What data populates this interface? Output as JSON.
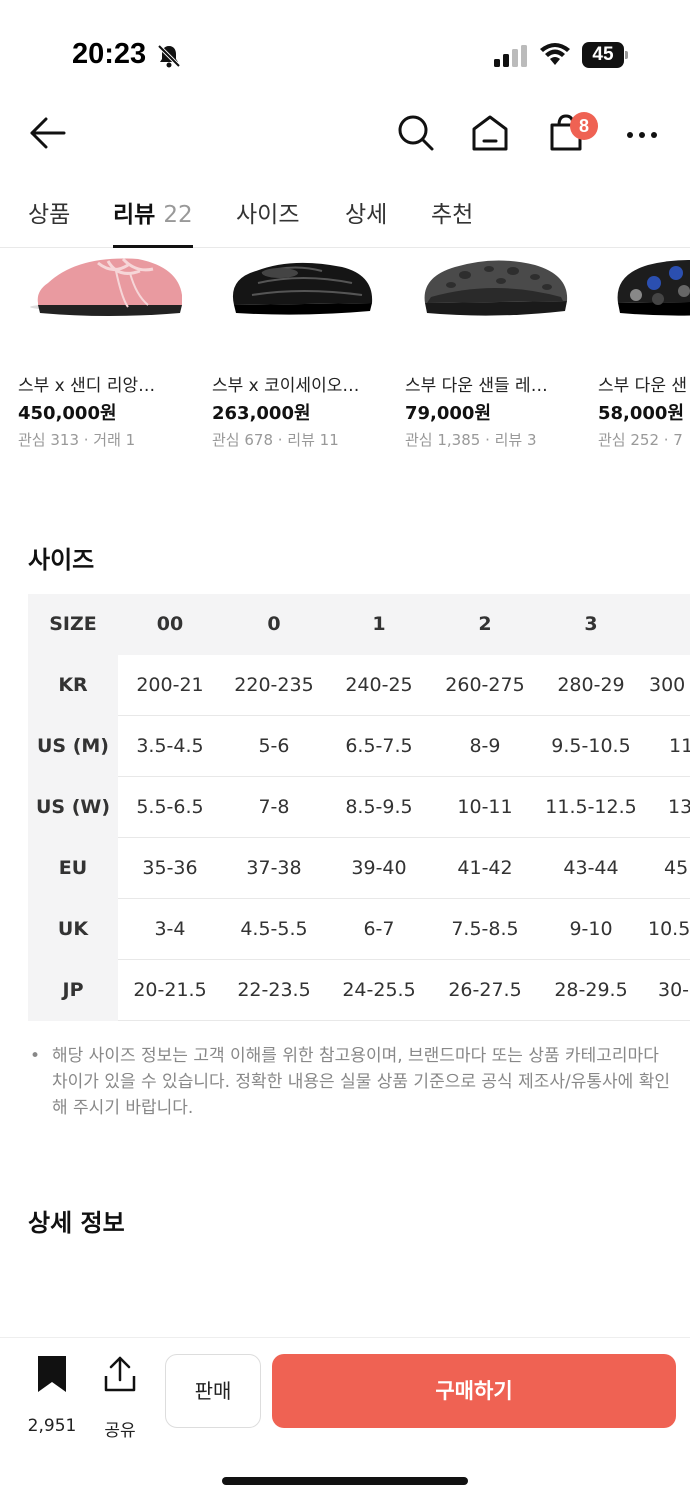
{
  "status_bar": {
    "time": "20:23",
    "battery": "45"
  },
  "header": {
    "cart_count": "8",
    "icons": [
      "back-arrow-icon",
      "search-icon",
      "home-icon",
      "cart-icon",
      "more-icon"
    ]
  },
  "tabs": [
    {
      "label": "상품"
    },
    {
      "label": "리뷰",
      "count": "22",
      "active": true
    },
    {
      "label": "사이즈"
    },
    {
      "label": "상세"
    },
    {
      "label": "추천"
    }
  ],
  "products": [
    {
      "name": "스부 x 샌디 리앙…",
      "price": "450,000원",
      "meta": "관심 313 · 거래 1"
    },
    {
      "name": "스부 x 코이세이오…",
      "price": "263,000원",
      "meta": "관심 678 · 리뷰 11"
    },
    {
      "name": "스부 다운 샌들 레…",
      "price": "79,000원",
      "meta": "관심 1,385 · 리뷰 3"
    },
    {
      "name": "스부 다운 샌",
      "price": "58,000원",
      "meta": "관심 252 · 7"
    }
  ],
  "size_section": {
    "title": "사이즈",
    "header": {
      "label": "SIZE",
      "values": [
        "00",
        "0",
        "1",
        "2",
        "3",
        ""
      ]
    },
    "rows": [
      {
        "label": "KR",
        "values": [
          "200-21",
          "220-235",
          "240-25",
          "260-275",
          "280-29",
          "300"
        ]
      },
      {
        "label": "US (M)",
        "values": [
          "3.5-4.5",
          "5-6",
          "6.5-7.5",
          "8-9",
          "9.5-10.5",
          "11"
        ]
      },
      {
        "label": "US (W)",
        "values": [
          "5.5-6.5",
          "7-8",
          "8.5-9.5",
          "10-11",
          "11.5-12.5",
          "13"
        ]
      },
      {
        "label": "EU",
        "values": [
          "35-36",
          "37-38",
          "39-40",
          "41-42",
          "43-44",
          "45"
        ]
      },
      {
        "label": "UK",
        "values": [
          "3-4",
          "4.5-5.5",
          "6-7",
          "7.5-8.5",
          "9-10",
          "10.5"
        ]
      },
      {
        "label": "JP",
        "values": [
          "20-21.5",
          "22-23.5",
          "24-25.5",
          "26-27.5",
          "28-29.5",
          "30-"
        ]
      }
    ],
    "notice_bullet": "•",
    "notice": "해당 사이즈 정보는 고객 이해를 위한 참고용이며, 브랜드마다 또는 상품 카테고리마다 차이가 있을 수 있습니다. 정확한 내용은 실물 상품 기준으로 공식 제조사/유통사에 확인해 주시기 바랍니다."
  },
  "detail_section": {
    "title": "상세 정보"
  },
  "bottom_bar": {
    "bookmark_count": "2,951",
    "share_label": "공유",
    "sell_label": "판매",
    "buy_label": "구매하기"
  },
  "colors": {
    "accent": "#ef6253",
    "table_header_bg": "#f4f4f5"
  }
}
